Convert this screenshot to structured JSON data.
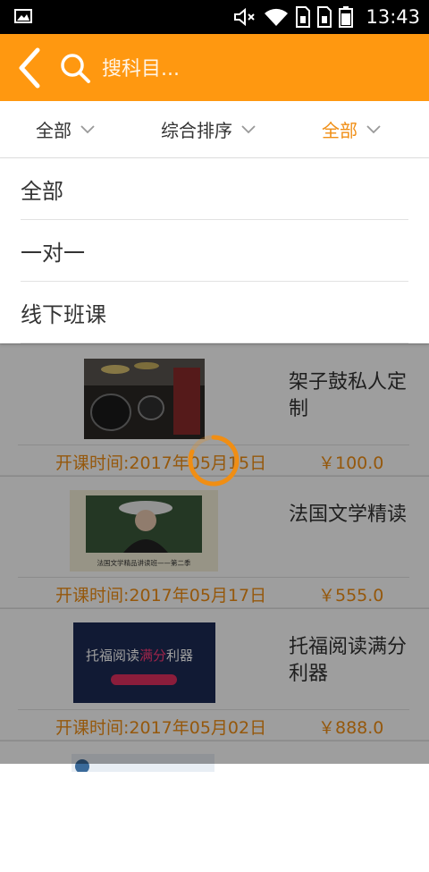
{
  "status_bar": {
    "time": "13:43",
    "icons": [
      "image-icon",
      "mute-icon",
      "wifi-icon",
      "sim1-icon",
      "sim2-icon",
      "battery-icon"
    ]
  },
  "header": {
    "search_placeholder": "搜科目..."
  },
  "filters": [
    {
      "label": "全部",
      "active": false
    },
    {
      "label": "综合排序",
      "active": false
    },
    {
      "label": "全部",
      "active": true
    }
  ],
  "dropdown": {
    "items": [
      "全部",
      "一对一",
      "线下班课"
    ]
  },
  "courses": [
    {
      "title": "架子鼓私人定制",
      "date": "开课时间:2017年05月15日",
      "date_visible": "开课时间:2017年05月",
      "date_tail": "5日",
      "price": "￥100.0"
    },
    {
      "title": "法国文学精读",
      "date": "开课时间:2017年05月17日",
      "price": "￥555.0",
      "thumb_caption": "法国文学精品讲读班——第二季"
    },
    {
      "title": "托福阅读满分利器",
      "date": "开课时间:2017年05月02日",
      "price": "￥888.0",
      "thumb_text_a": "托福阅读",
      "thumb_text_b": "满分",
      "thumb_text_c": "利器"
    }
  ],
  "colors": {
    "accent": "#ff9810",
    "accent_text": "#f08e14"
  }
}
